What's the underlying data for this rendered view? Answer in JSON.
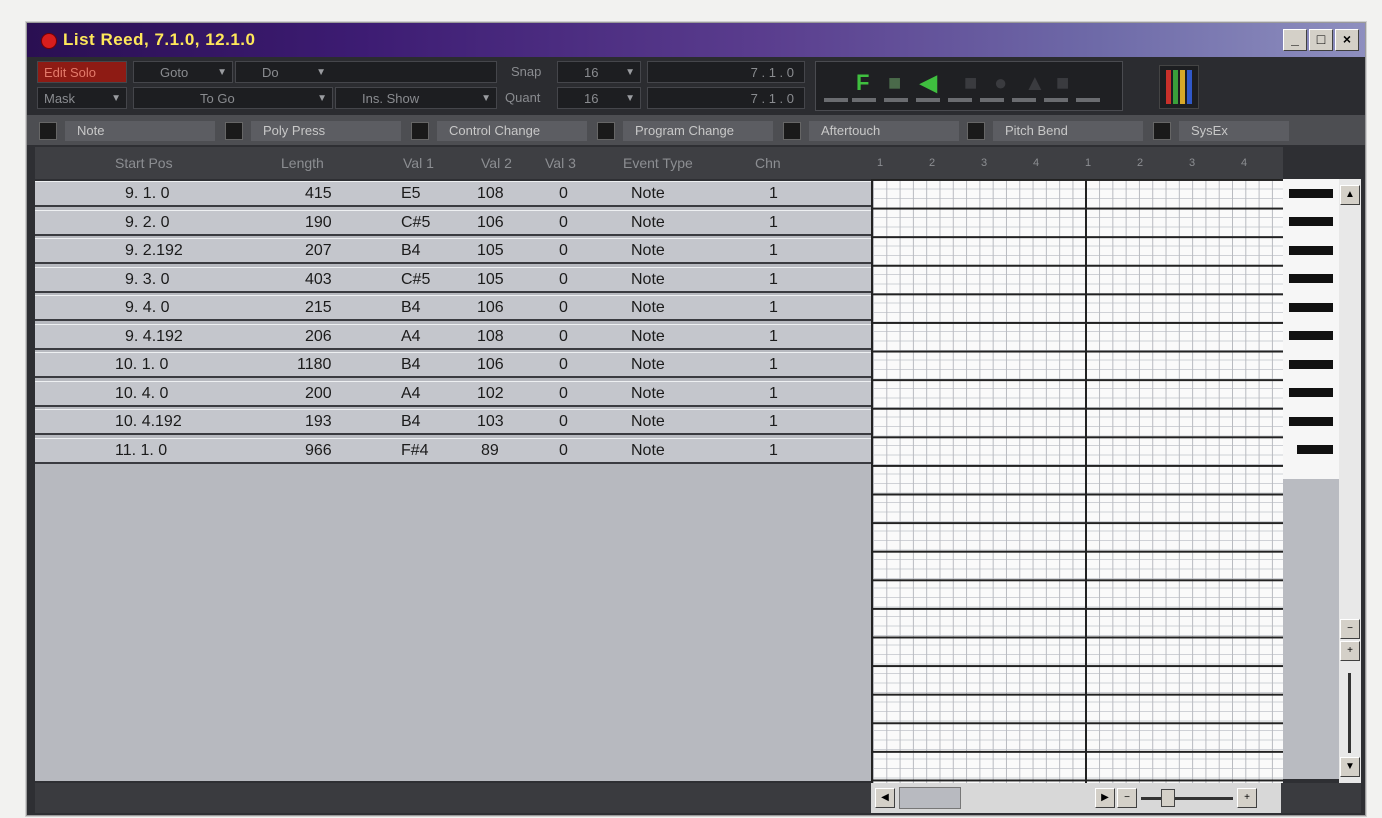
{
  "window": {
    "title": "List   Reed, 7.1.0, 12.1.0",
    "buttons": [
      "_",
      "□",
      "×"
    ]
  },
  "toolbar": {
    "edit_solo": "Edit Solo",
    "goto": "Goto",
    "do": "Do",
    "mask": "Mask",
    "to_go": "To Go",
    "ins_show": "Ins. Show",
    "snap_label": "Snap",
    "snap_value": "16",
    "quant_label": "Quant",
    "quant_value": "16",
    "pos1": "7 . 1 .   0",
    "pos2": "7 . 1 .   0"
  },
  "transport": {
    "f_label": "F",
    "play_symbol": "◀"
  },
  "filters": [
    {
      "label": "Note"
    },
    {
      "label": "Poly Press"
    },
    {
      "label": "Control Change"
    },
    {
      "label": "Program Change"
    },
    {
      "label": "Aftertouch"
    },
    {
      "label": "Pitch Bend"
    },
    {
      "label": "SysEx"
    }
  ],
  "columns": {
    "start_pos": "Start Pos",
    "length": "Length",
    "val1": "Val 1",
    "val2": "Val 2",
    "val3": "Val 3",
    "event_type": "Event Type",
    "chn": "Chn"
  },
  "ruler": [
    "1",
    "2",
    "3",
    "4",
    "1",
    "2",
    "3",
    "4"
  ],
  "rows": [
    {
      "pos": "9.  1.    0",
      "length": "415",
      "val1": "E5",
      "val2": "108",
      "val3": "0",
      "type": "Note",
      "chn": "1"
    },
    {
      "pos": "9.  2.    0",
      "length": "190",
      "val1": "C#5",
      "val2": "106",
      "val3": "0",
      "type": "Note",
      "chn": "1"
    },
    {
      "pos": "9.  2.192",
      "length": "207",
      "val1": "B4",
      "val2": "105",
      "val3": "0",
      "type": "Note",
      "chn": "1"
    },
    {
      "pos": "9.  3.    0",
      "length": "403",
      "val1": "C#5",
      "val2": "105",
      "val3": "0",
      "type": "Note",
      "chn": "1"
    },
    {
      "pos": "9.  4.    0",
      "length": "215",
      "val1": "B4",
      "val2": "106",
      "val3": "0",
      "type": "Note",
      "chn": "1"
    },
    {
      "pos": "9.  4.192",
      "length": "206",
      "val1": "A4",
      "val2": "108",
      "val3": "0",
      "type": "Note",
      "chn": "1"
    },
    {
      "pos": "10.  1.    0",
      "length": "1180",
      "val1": "B4",
      "val2": "106",
      "val3": "0",
      "type": "Note",
      "chn": "1"
    },
    {
      "pos": "10.  4.    0",
      "length": "200",
      "val1": "A4",
      "val2": "102",
      "val3": "0",
      "type": "Note",
      "chn": "1"
    },
    {
      "pos": "10.  4.192",
      "length": "193",
      "val1": "B4",
      "val2": "103",
      "val3": "0",
      "type": "Note",
      "chn": "1"
    },
    {
      "pos": "11.  1.    0",
      "length": "966",
      "val1": "F#4",
      "val2": "89",
      "val3": "0",
      "type": "Note",
      "chn": "1"
    }
  ],
  "colors": {
    "title_text": "#ffe85a",
    "edit_solo_bg": "#8e1b14",
    "transport_green": "#3fbf3f",
    "row_bg": "#c4c6cc"
  },
  "icons": {
    "window_close": "close-icon",
    "record_dot": "record-dot-icon",
    "meter": "level-meter-icon"
  }
}
